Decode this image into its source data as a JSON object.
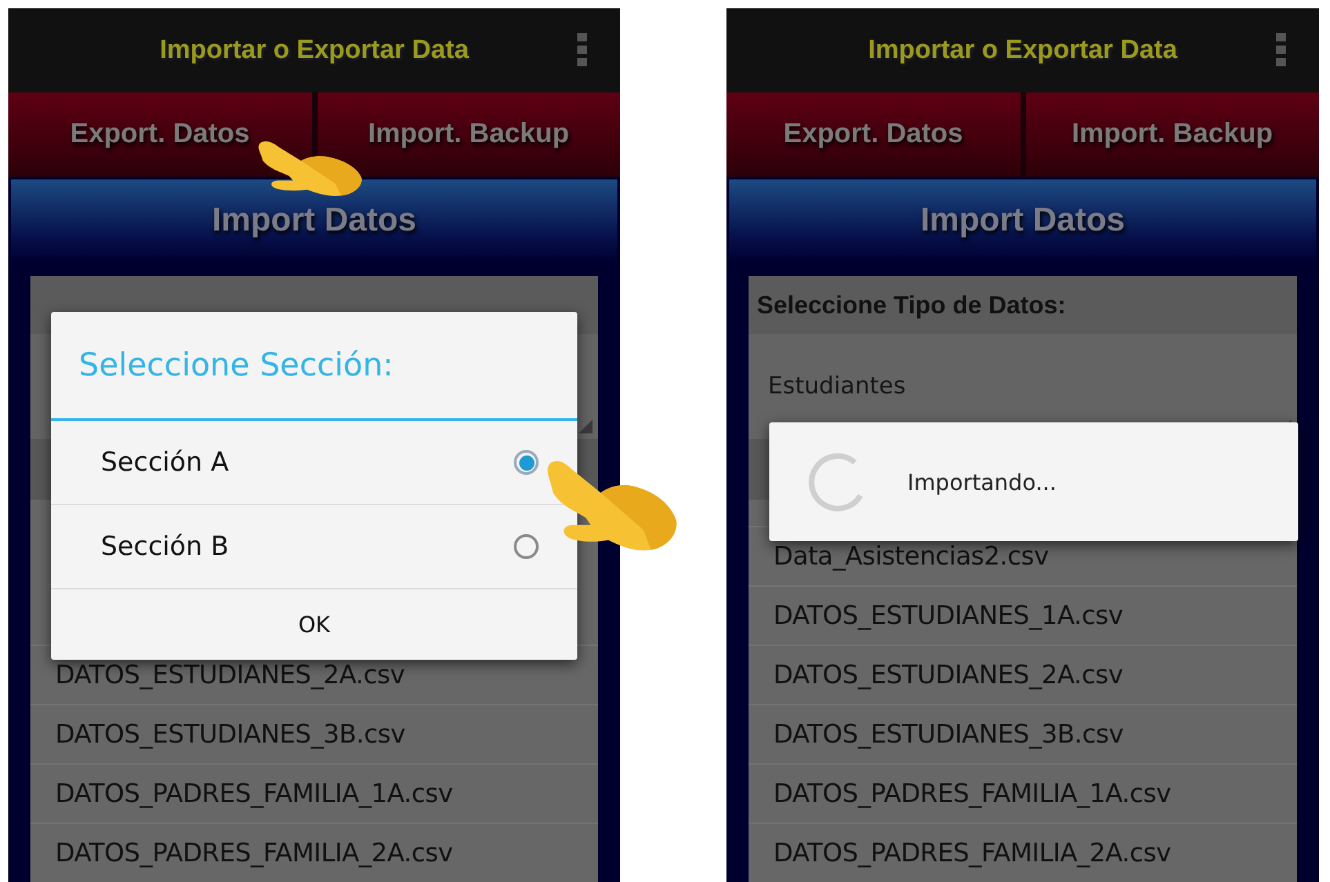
{
  "screens": [
    {
      "app_bar": {
        "title": "Importar o Exportar Data"
      },
      "tabs": [
        {
          "label": "Export. Datos"
        },
        {
          "label": "Import. Backup"
        }
      ],
      "section_title": "Import Datos",
      "panel": {
        "files": [
          "DATOS_ESTUDIANES_2A.csv",
          "DATOS_ESTUDIANES_3B.csv",
          "DATOS_PADRES_FAMILIA_1A.csv",
          "DATOS_PADRES_FAMILIA_2A.csv"
        ]
      },
      "dialog": {
        "kind": "choice",
        "title": "Seleccione Sección:",
        "options": [
          {
            "label": "Sección A",
            "selected": true
          },
          {
            "label": "Sección B",
            "selected": false
          }
        ],
        "button": "OK"
      }
    },
    {
      "app_bar": {
        "title": "Importar o Exportar Data"
      },
      "tabs": [
        {
          "label": "Export. Datos"
        },
        {
          "label": "Import. Backup"
        }
      ],
      "section_title": "Import Datos",
      "panel": {
        "header": "Seleccione Tipo de Datos:",
        "spinner_value": "Estudiantes",
        "files": [
          "Data_Asistencias2.csv",
          "DATOS_ESTUDIANES_1A.csv",
          "DATOS_ESTUDIANES_2A.csv",
          "DATOS_ESTUDIANES_3B.csv",
          "DATOS_PADRES_FAMILIA_1A.csv",
          "DATOS_PADRES_FAMILIA_2A.csv"
        ]
      },
      "dialog": {
        "kind": "progress",
        "message": "Importando..."
      }
    }
  ]
}
